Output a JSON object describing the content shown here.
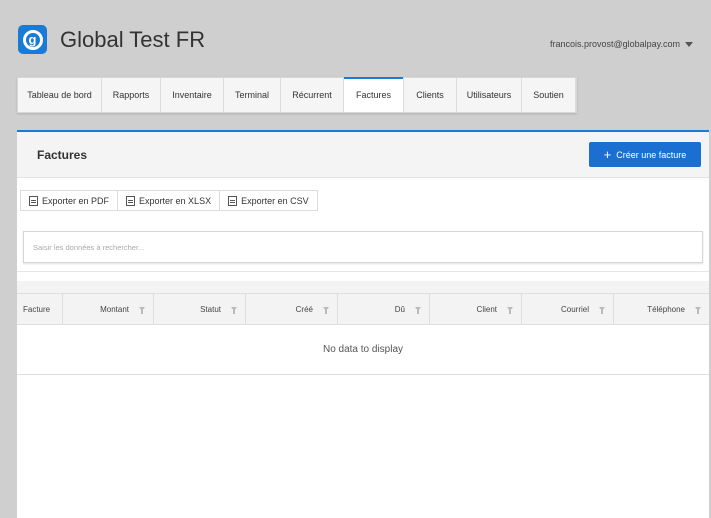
{
  "header": {
    "app_title": "Global Test FR",
    "user_email": "francois.provost@globalpay.com"
  },
  "tabs": [
    {
      "label": "Tableau de bord"
    },
    {
      "label": "Rapports"
    },
    {
      "label": "Inventaire"
    },
    {
      "label": "Terminal"
    },
    {
      "label": "Récurrent"
    },
    {
      "label": "Factures",
      "active": true
    },
    {
      "label": "Clients"
    },
    {
      "label": "Utilisateurs"
    },
    {
      "label": "Soutien"
    }
  ],
  "panel": {
    "title": "Factures",
    "create_button": "Créer une facture",
    "accent_color": "#1a7bd6"
  },
  "exports": [
    {
      "label": "Exporter en PDF",
      "icon": "document-icon"
    },
    {
      "label": "Exporter en XLSX",
      "icon": "document-icon"
    },
    {
      "label": "Exporter en CSV",
      "icon": "document-icon"
    }
  ],
  "search": {
    "placeholder": "Saisir les données à rechercher...",
    "value": ""
  },
  "grid": {
    "columns": [
      "Facture",
      "Montant",
      "Statut",
      "Créé",
      "Dû",
      "Client",
      "Courriel",
      "Téléphone"
    ],
    "empty_text": "No data to display"
  }
}
